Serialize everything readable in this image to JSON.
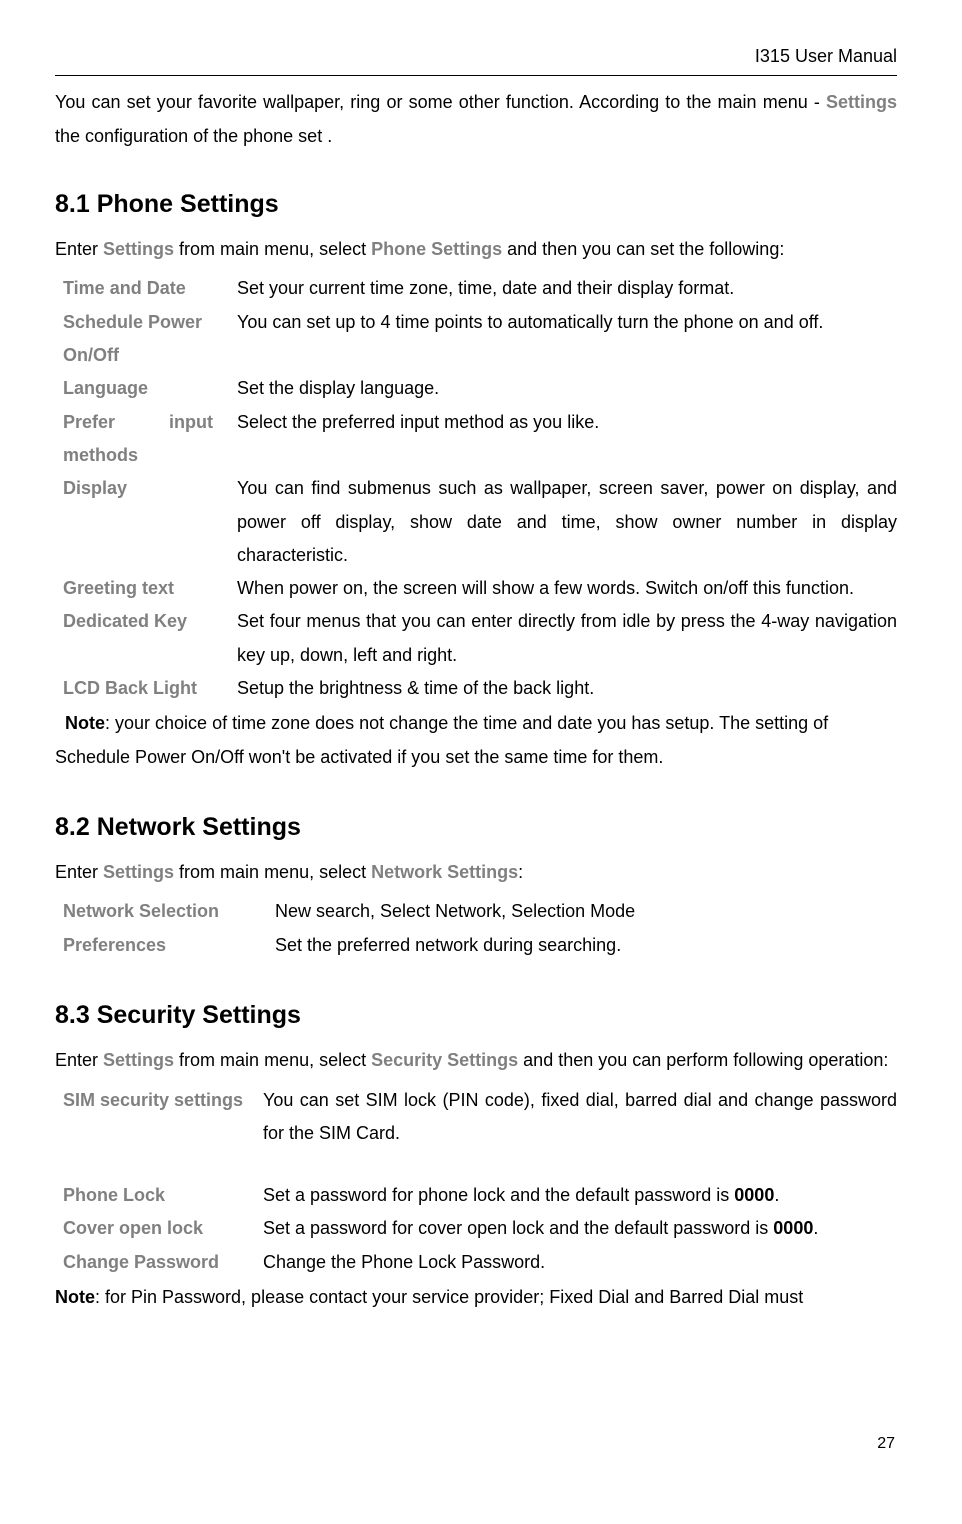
{
  "header": {
    "title": "I315 User Manual"
  },
  "intro": {
    "pre": "You can set your favorite wallpaper, ring or some other function. According to the main menu - ",
    "link": "Settings",
    "post": " the configuration of the phone set ."
  },
  "section81": {
    "heading": "8.1 Phone Settings",
    "intro_pre": "Enter ",
    "intro_link1": "Settings",
    "intro_mid": " from main menu, select ",
    "intro_link2": "Phone Settings",
    "intro_post": " and then you can set the following:",
    "rows": [
      {
        "label": "Time and Date",
        "desc": "Set your current time zone, time, date and their display format."
      },
      {
        "label": "Schedule Power On/Off",
        "desc": "You can set up to 4 time points to automatically turn the phone on and off."
      },
      {
        "label": "Language",
        "desc": "Set the display language."
      },
      {
        "label_a": "Prefer",
        "label_b": "input",
        "label_c": "methods",
        "desc": "Select the preferred input method as you like."
      },
      {
        "label": "Display",
        "desc": "You can find submenus such as wallpaper, screen saver, power on display, and power off display, show date and time, show owner number in display characteristic."
      },
      {
        "label": "Greeting text",
        "desc": "When power on, the screen will show a few words. Switch on/off this function."
      },
      {
        "label": "Dedicated Key",
        "desc": "Set four menus that you can enter directly from idle by press the 4-way navigation key up, down, left and right."
      },
      {
        "label": "LCD Back Light",
        "desc": "Setup the brightness & time of the back light."
      }
    ],
    "note_label": "Note",
    "note_text": ": your choice of time zone does not change the time and date you has setup. The setting of Schedule Power On/Off won't be activated if you set the same time for them."
  },
  "section82": {
    "heading": "8.2 Network Settings",
    "intro_pre": "Enter ",
    "intro_link1": "Settings",
    "intro_mid": " from main menu, select ",
    "intro_link2": "Network Settings",
    "intro_post": ":",
    "rows": [
      {
        "label": "Network Selection",
        "desc": "New search, Select Network, Selection Mode"
      },
      {
        "label": "Preferences",
        "desc": "Set the preferred network during searching."
      }
    ]
  },
  "section83": {
    "heading": "8.3 Security Settings",
    "intro_pre": "Enter ",
    "intro_link1": "Settings",
    "intro_mid": " from main menu, select ",
    "intro_link2": "Security Settings",
    "intro_post": " and then you can perform following operation:",
    "rows": [
      {
        "label": "SIM security settings",
        "desc": "You can set SIM lock (PIN code), fixed dial, barred dial and change password for the SIM Card."
      },
      {
        "label": "Phone Lock",
        "desc_pre": "Set a password for phone lock and the default password is ",
        "pw": "0000",
        "desc_post": "."
      },
      {
        "label": "Cover open lock",
        "desc_pre": "Set a password for cover open lock and the default password is ",
        "pw": "0000",
        "desc_post": "."
      },
      {
        "label": "Change Password",
        "desc": "Change the Phone Lock Password."
      }
    ],
    "note_label": "Note",
    "note_text": ": for Pin Password, please contact your service provider; Fixed Dial and Barred Dial must"
  },
  "page_number": "27"
}
